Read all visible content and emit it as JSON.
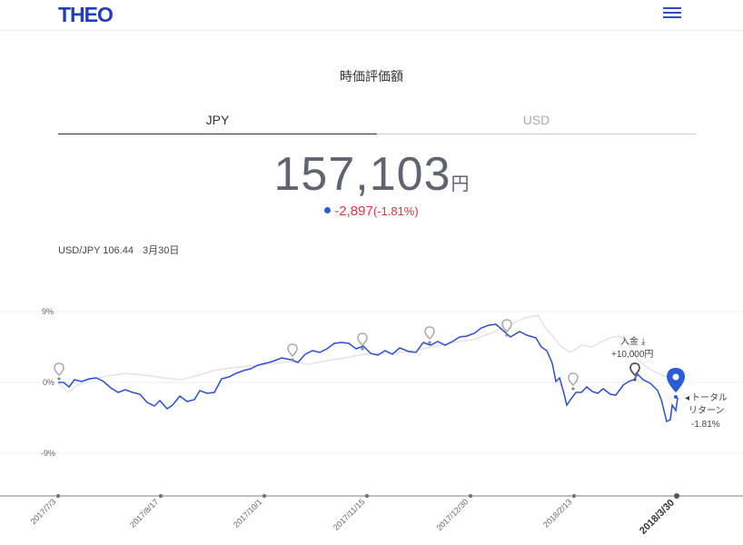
{
  "header": {
    "logo": "THEO",
    "menu_icon": "hamburger-menu-icon",
    "brand_color": "#1f3fbf"
  },
  "page": {
    "title": "時価評価額"
  },
  "tabs": [
    {
      "label": "JPY",
      "active": true
    },
    {
      "label": "USD",
      "active": false
    }
  ],
  "value": {
    "amount": "157,103",
    "unit": "円"
  },
  "change": {
    "amount": "-2,897",
    "percent": "(-1.81%)",
    "color": "#d9363e"
  },
  "fx": {
    "rate_label": "USD/JPY 106.44",
    "date": "3月30日"
  },
  "chart": {
    "y_ticks": [
      "9%",
      "0%",
      "-9%"
    ],
    "x_labels": [
      "2017/7/3",
      "2017/8/17",
      "2017/10/1",
      "2017/11/15",
      "2017/12/30",
      "2018/2/13",
      "2018/3/30"
    ],
    "deposit_label": "入金",
    "deposit_icon": "deposit-icon",
    "deposit_amount": "+10,000円",
    "total_return_label_1": "トータル",
    "total_return_label_2": "リターン",
    "total_return_value": "-1.81%",
    "series_color": "#2a4fd6",
    "benchmark_color": "#e3e3e3"
  },
  "chart_data": {
    "type": "line",
    "y_unit": "%",
    "ylim": [
      -9,
      9
    ],
    "x": [
      "2017/7/3",
      "2017/8/17",
      "2017/10/1",
      "2017/11/15",
      "2017/12/30",
      "2018/2/13",
      "2018/3/30"
    ],
    "series": [
      {
        "values": [
          0.0,
          -2.8,
          2.6,
          4.4,
          5.3,
          -2.5,
          -1.81
        ]
      },
      {
        "values": [
          0.0,
          1.0,
          2.0,
          3.8,
          5.0,
          3.0,
          -0.5
        ]
      }
    ]
  }
}
